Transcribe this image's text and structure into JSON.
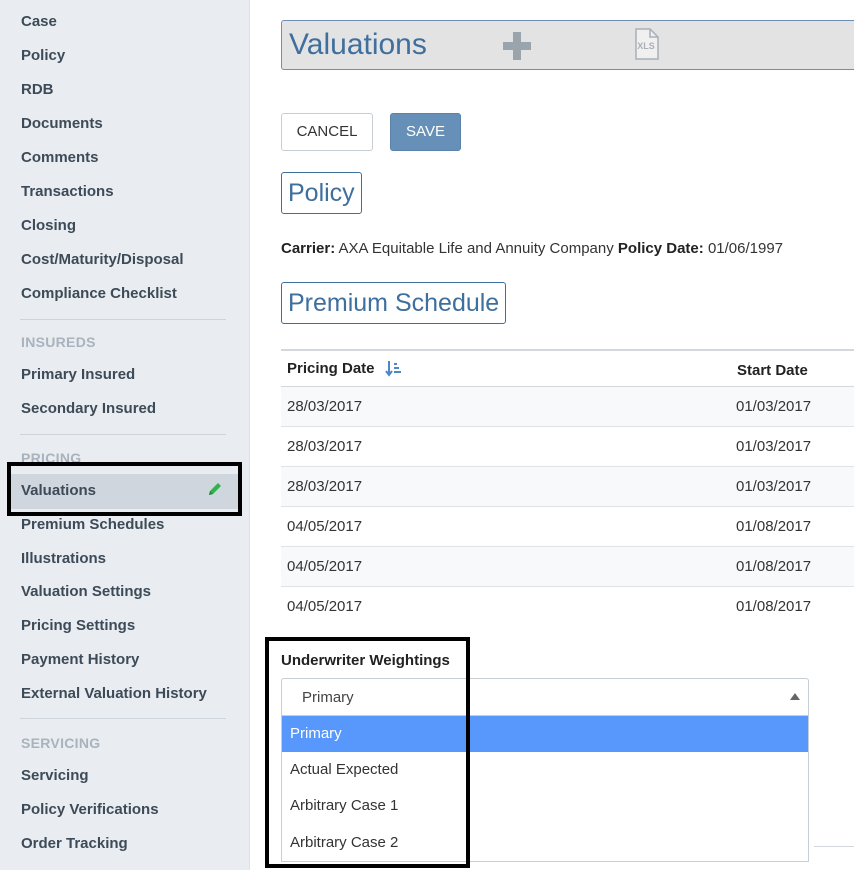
{
  "sidebar": {
    "case_items": [
      "Case",
      "Policy",
      "RDB",
      "Documents",
      "Comments",
      "Transactions",
      "Closing",
      "Cost/Maturity/Disposal",
      "Compliance Checklist"
    ],
    "insureds": {
      "heading": "INSUREDS",
      "items": [
        "Primary Insured",
        "Secondary Insured"
      ]
    },
    "pricing": {
      "heading": "PRICING",
      "items": [
        "Valuations",
        "Premium Schedules",
        "Illustrations",
        "Valuation Settings",
        "Pricing Settings",
        "Payment History",
        "External Valuation History"
      ]
    },
    "servicing": {
      "heading": "SERVICING",
      "items": [
        "Servicing",
        "Policy Verifications",
        "Order Tracking"
      ]
    },
    "active_item": "Valuations",
    "active_edit_icon": "pencil-icon"
  },
  "header": {
    "title": "Valuations",
    "icons": [
      "plus-icon",
      "xls-file-icon"
    ],
    "xls_glyph_text": "XLS"
  },
  "actions": {
    "cancel_label": "CANCEL",
    "save_label": "SAVE"
  },
  "policy": {
    "heading": "Policy",
    "carrier_label": "Carrier:",
    "carrier_value": "AXA Equitable Life and Annuity Company",
    "policy_date_label": "Policy Date:",
    "policy_date_value": "01/06/1997"
  },
  "premium_schedule": {
    "heading": "Premium Schedule",
    "columns": [
      "Pricing Date",
      "Start Date"
    ],
    "sort_icon": "sort-descending-icon",
    "rows": [
      [
        "28/03/2017",
        "01/03/2017"
      ],
      [
        "28/03/2017",
        "01/03/2017"
      ],
      [
        "28/03/2017",
        "01/03/2017"
      ],
      [
        "04/05/2017",
        "01/08/2017"
      ],
      [
        "04/05/2017",
        "01/08/2017"
      ],
      [
        "04/05/2017",
        "01/08/2017"
      ]
    ]
  },
  "underwriter_weightings": {
    "label": "Underwriter Weightings",
    "selected": "Primary",
    "options": [
      "Primary",
      "Actual Expected",
      "Arbitrary Case 1",
      "Arbitrary Case 2"
    ],
    "highlighted_option": "Primary"
  },
  "colors": {
    "accent": "#3f6f9c",
    "save_button": "#6690b8",
    "highlight_option": "#5897fb",
    "sidebar_bg": "#e9edf1",
    "edit_icon": "#2fb34a",
    "callout_border": "#000000"
  }
}
